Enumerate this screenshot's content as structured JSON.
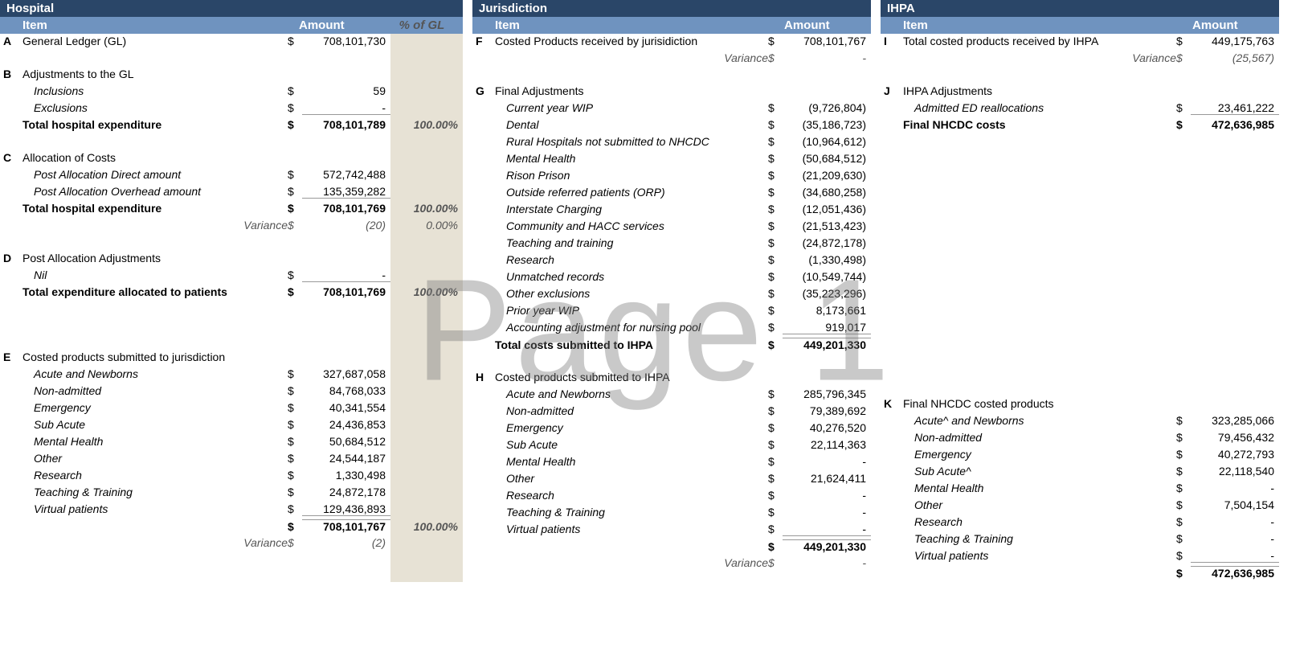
{
  "watermark": "Page 1",
  "headers": {
    "item": "Item",
    "amount": "Amount",
    "pct": "% of GL"
  },
  "hospital": {
    "title": "Hospital",
    "A": {
      "label": "General Ledger (GL)",
      "amount": "708,101,730"
    },
    "B": {
      "label": "Adjustments to the GL",
      "inclusions_label": "Inclusions",
      "inclusions_amt": "59",
      "exclusions_label": "Exclusions",
      "exclusions_amt": "-",
      "total_label": "Total hospital expenditure",
      "total_amt": "708,101,789",
      "total_pct": "100.00%"
    },
    "C": {
      "label": "Allocation of Costs",
      "direct_label": "Post Allocation Direct amount",
      "direct_amt": "572,742,488",
      "overhead_label": "Post Allocation Overhead amount",
      "overhead_amt": "135,359,282",
      "total_label": "Total hospital expenditure",
      "total_amt": "708,101,769",
      "total_pct": "100.00%",
      "variance_label": "Variance",
      "variance_amt": "(20)",
      "variance_pct": "0.00%"
    },
    "D": {
      "label": "Post Allocation Adjustments",
      "nil_label": "Nil",
      "nil_amt": "-",
      "total_label": "Total expenditure allocated to patients",
      "total_amt": "708,101,769",
      "total_pct": "100.00%"
    },
    "E": {
      "label": "Costed products submitted to jurisdiction",
      "rows": [
        {
          "label": "Acute and Newborns",
          "amt": "327,687,058"
        },
        {
          "label": "Non-admitted",
          "amt": "84,768,033"
        },
        {
          "label": "Emergency",
          "amt": "40,341,554"
        },
        {
          "label": "Sub Acute",
          "amt": "24,436,853"
        },
        {
          "label": "Mental Health",
          "amt": "50,684,512"
        },
        {
          "label": "Other",
          "amt": "24,544,187"
        },
        {
          "label": "Research",
          "amt": "1,330,498"
        },
        {
          "label": "Teaching & Training",
          "amt": "24,872,178"
        },
        {
          "label": "Virtual patients",
          "amt": "129,436,893"
        }
      ],
      "total_amt": "708,101,767",
      "total_pct": "100.00%",
      "variance_label": "Variance",
      "variance_amt": "(2)"
    }
  },
  "jurisdiction": {
    "title": "Jurisdiction",
    "F": {
      "label": "Costed Products received by jurisidiction",
      "amount": "708,101,767",
      "variance_label": "Variance",
      "variance_amt": "-"
    },
    "G": {
      "label": "Final Adjustments",
      "rows": [
        {
          "label": "Current year WIP",
          "amt": "(9,726,804)"
        },
        {
          "label": "Dental",
          "amt": "(35,186,723)"
        },
        {
          "label": "Rural Hospitals not submitted to NHCDC",
          "amt": "(10,964,612)"
        },
        {
          "label": "Mental Health",
          "amt": "(50,684,512)"
        },
        {
          "label": "Rison Prison",
          "amt": "(21,209,630)"
        },
        {
          "label": "Outside referred patients (ORP)",
          "amt": "(34,680,258)"
        },
        {
          "label": "Interstate Charging",
          "amt": "(12,051,436)"
        },
        {
          "label": "Community and HACC services",
          "amt": "(21,513,423)"
        },
        {
          "label": "Teaching and training",
          "amt": "(24,872,178)"
        },
        {
          "label": "Research",
          "amt": "(1,330,498)"
        },
        {
          "label": "Unmatched records",
          "amt": "(10,549,744)"
        },
        {
          "label": "Other exclusions",
          "amt": "(35,223,296)"
        },
        {
          "label": "Prior year WIP",
          "amt": "8,173,661"
        },
        {
          "label": "Accounting adjustment for nursing pool",
          "amt": "919,017"
        }
      ],
      "total_label": "Total costs submitted to IHPA",
      "total_amt": "449,201,330"
    },
    "H": {
      "label": "Costed products submitted to IHPA",
      "rows": [
        {
          "label": "Acute and Newborns",
          "amt": "285,796,345"
        },
        {
          "label": "Non-admitted",
          "amt": "79,389,692"
        },
        {
          "label": "Emergency",
          "amt": "40,276,520"
        },
        {
          "label": "Sub Acute",
          "amt": "22,114,363"
        },
        {
          "label": "Mental Health",
          "amt": "-"
        },
        {
          "label": "Other",
          "amt": "21,624,411"
        },
        {
          "label": "Research",
          "amt": "-"
        },
        {
          "label": "Teaching & Training",
          "amt": "-"
        },
        {
          "label": "Virtual patients",
          "amt": "-"
        }
      ],
      "total_amt": "449,201,330",
      "variance_label": "Variance",
      "variance_amt": "-"
    }
  },
  "ihpa": {
    "title": "IHPA",
    "I": {
      "label": "Total costed products received by IHPA",
      "amount": "449,175,763",
      "variance_label": "Variance",
      "variance_amt": "(25,567)"
    },
    "J": {
      "label": "IHPA Adjustments",
      "admitted_label": "Admitted ED reallocations",
      "admitted_amt": "23,461,222",
      "total_label": "Final NHCDC costs",
      "total_amt": "472,636,985"
    },
    "K": {
      "label": "Final NHCDC costed products",
      "rows": [
        {
          "label": "Acute^ and Newborns",
          "amt": "323,285,066"
        },
        {
          "label": "Non-admitted",
          "amt": "79,456,432"
        },
        {
          "label": "Emergency",
          "amt": "40,272,793"
        },
        {
          "label": "Sub Acute^",
          "amt": "22,118,540"
        },
        {
          "label": "Mental Health",
          "amt": "-"
        },
        {
          "label": "Other",
          "amt": "7,504,154"
        },
        {
          "label": "Research",
          "amt": "-"
        },
        {
          "label": "Teaching & Training",
          "amt": "-"
        },
        {
          "label": "Virtual patients",
          "amt": "-"
        }
      ],
      "total_amt": "472,636,985"
    }
  }
}
